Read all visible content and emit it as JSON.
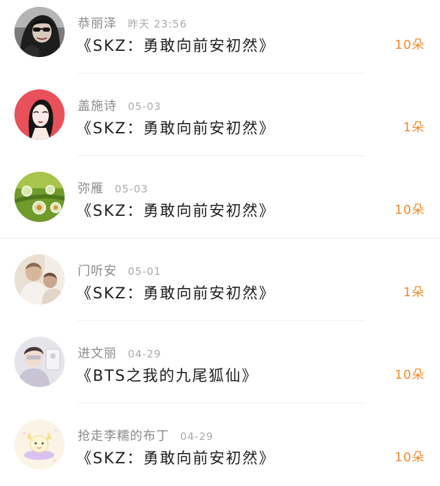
{
  "gifts": [
    {
      "name": "恭丽泽",
      "date": "昨天 23:56",
      "title": "《SKZ：勇敢向前安初然》",
      "count": "10朵"
    },
    {
      "name": "盖施诗",
      "date": "05-03",
      "title": "《SKZ：勇敢向前安初然》",
      "count": "1朵"
    },
    {
      "name": "弥雁",
      "date": "05-03",
      "title": "《SKZ：勇敢向前安初然》",
      "count": "10朵"
    },
    {
      "name": "门听安",
      "date": "05-01",
      "title": "《SKZ：勇敢向前安初然》",
      "count": "1朵"
    },
    {
      "name": "进文丽",
      "date": "04-29",
      "title": "《BTS之我的九尾狐仙》",
      "count": "10朵"
    },
    {
      "name": "抢走李糯的布丁",
      "date": "04-29",
      "title": "《SKZ：勇敢向前安初然》",
      "count": "10朵"
    }
  ],
  "colors": {
    "accent": "#f08a2a",
    "username": "#8a8a8a",
    "date": "#a9a9a9",
    "title": "#1e1e1e"
  }
}
